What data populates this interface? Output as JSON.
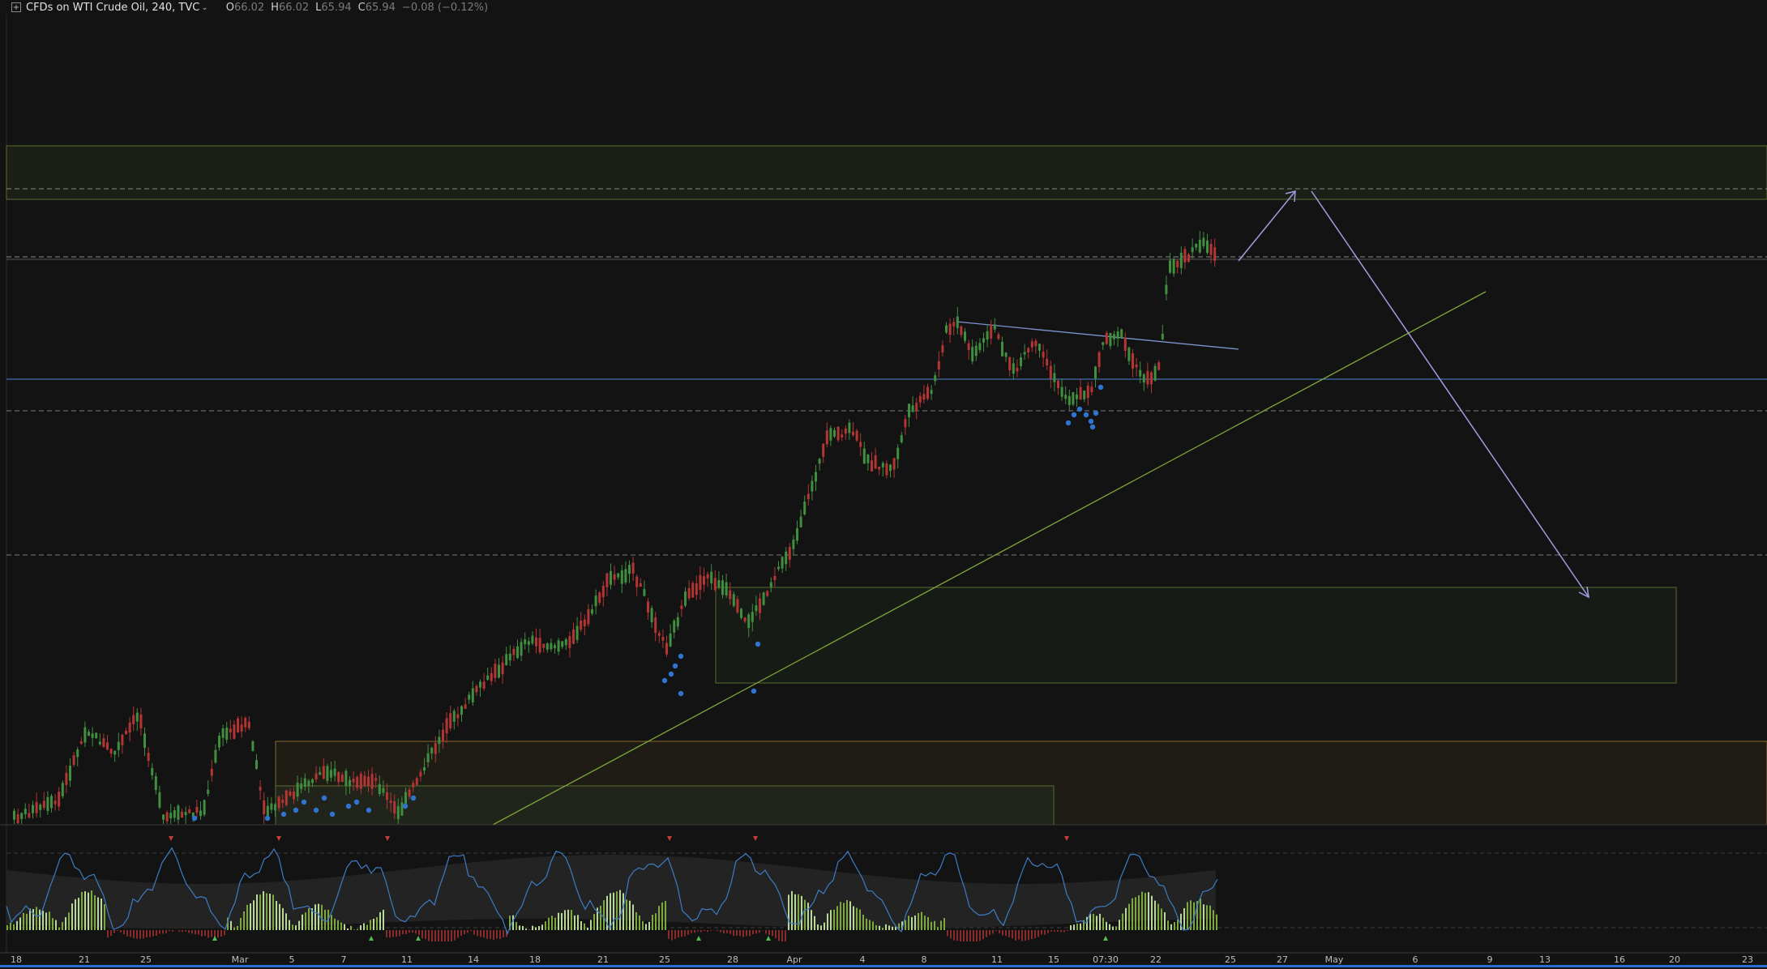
{
  "legend": {
    "symbol": "CFDs on WTI Crude Oil, 240, TVC",
    "caret": "⌄",
    "open_key": "O",
    "open": "66.02",
    "high_key": "H",
    "high": "66.02",
    "low_key": "L",
    "low": "65.94",
    "close_key": "C",
    "close": "65.94",
    "change": "−0.08 (−0.12%)",
    "collapse_icon": "plus-square-icon"
  },
  "time_axis": {
    "ticks": [
      "18",
      "21",
      "25",
      "Mar",
      "5",
      "7",
      "11",
      "14",
      "18",
      "21",
      "25",
      "28",
      "Apr",
      "4",
      "8",
      "11",
      "15",
      "07:30",
      "22",
      "25",
      "27",
      "May",
      "6",
      "9",
      "13",
      "16",
      "20",
      "23"
    ]
  },
  "colors": {
    "background": "#131313",
    "up_candle": "#3f8f3f",
    "down_candle": "#b53535",
    "zone_green": "#7c8f3a",
    "zone_orange": "#8a6a2a",
    "trend_blue": "#6f8fc9",
    "arrow_purple": "#a29de0",
    "oscillator": "#3e7cc4",
    "accent": "#2b6fd6"
  }
}
